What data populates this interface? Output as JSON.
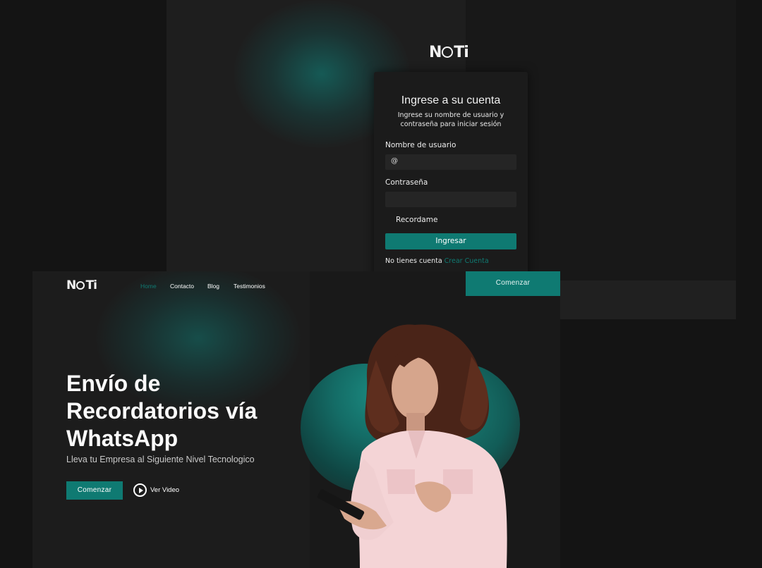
{
  "login": {
    "logo": "NOTi",
    "title": "Ingrese a su cuenta",
    "subtitle": "Ingrese su nombre de usuario y contraseña para iniciar sesión",
    "username_label": "Nombre de usuario",
    "username_prefix": "@",
    "password_label": "Contraseña",
    "remember_label": "Recordame",
    "submit_label": "Ingresar",
    "no_account_text": "No tienes cuenta",
    "create_account_link": "Crear Cuenta"
  },
  "landing": {
    "logo": "NOTi",
    "nav": [
      "Home",
      "Contacto",
      "Blog",
      "Testimonios"
    ],
    "active_nav": "Home",
    "cta_top": "Comenzar",
    "hero_title": "Envío de Recordatorios vía WhatsApp",
    "hero_subtitle": "Lleva tu Empresa al Siguiente Nivel Tecnologico",
    "hero_button": "Comenzar",
    "video_label": "Ver Video"
  },
  "colors": {
    "accent": "#0f7a72",
    "background": "#1c1c1c"
  },
  "icons": [
    "play-icon",
    "person-photo"
  ]
}
